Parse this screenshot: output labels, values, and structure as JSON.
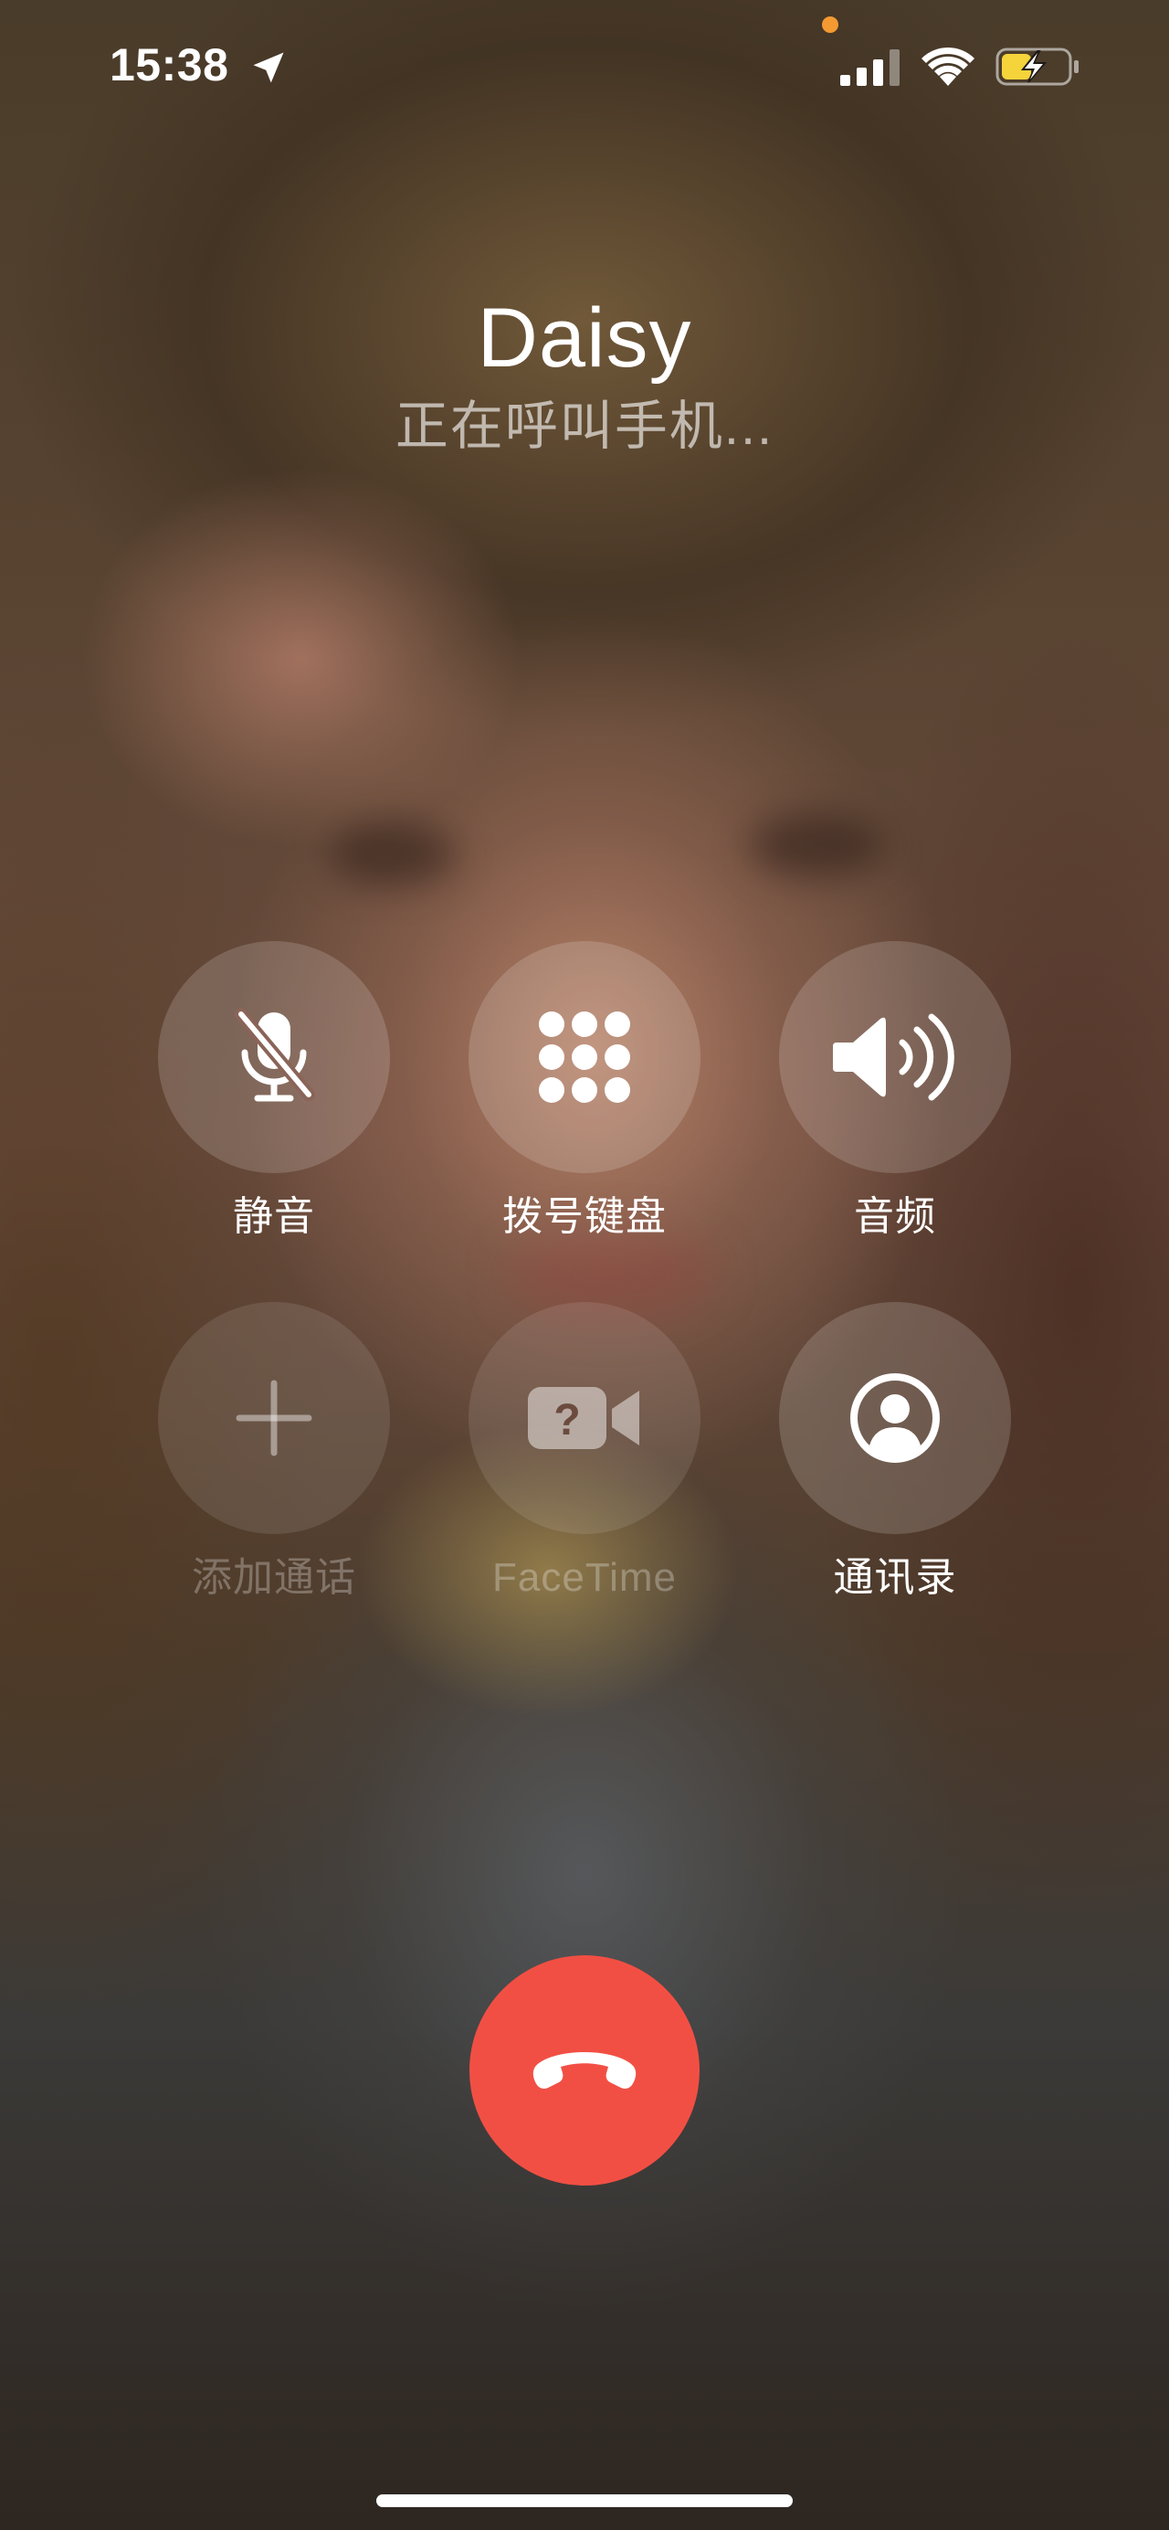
{
  "status_bar": {
    "time": "15:38",
    "location_icon": "location-arrow-icon",
    "privacy_indicator_color": "#f39a32",
    "signal_bars": 3,
    "signal_icon": "cellular-signal-icon",
    "wifi_icon": "wifi-icon",
    "battery_icon": "battery-charging-icon",
    "battery_level": 0.45,
    "battery_fill_color": "#f5d33b"
  },
  "call": {
    "caller_name": "Daisy",
    "status": "正在呼叫手机..."
  },
  "controls": [
    {
      "key": "mute",
      "label": "静音",
      "icon": "microphone-slash-icon",
      "enabled": true
    },
    {
      "key": "keypad",
      "label": "拨号键盘",
      "icon": "keypad-grid-icon",
      "enabled": true
    },
    {
      "key": "audio",
      "label": "音频",
      "icon": "speaker-wave-icon",
      "enabled": true
    },
    {
      "key": "add_call",
      "label": "添加通话",
      "icon": "plus-icon",
      "enabled": false
    },
    {
      "key": "facetime",
      "label": "FaceTime",
      "icon": "video-camera-question-icon",
      "enabled": false
    },
    {
      "key": "contacts",
      "label": "通讯录",
      "icon": "person-circle-icon",
      "enabled": true
    }
  ],
  "end_call": {
    "icon": "phone-hangup-icon",
    "color": "#f24f44"
  }
}
